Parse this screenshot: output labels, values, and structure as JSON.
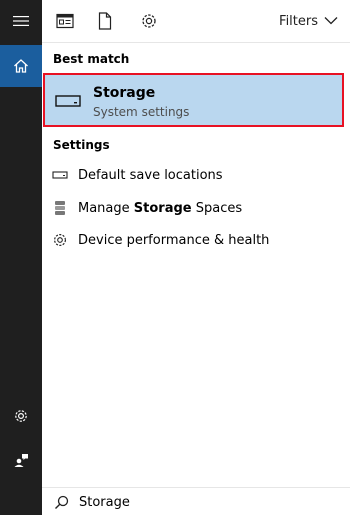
{
  "rail": {
    "items": [
      {
        "name": "menu-icon"
      },
      {
        "name": "home-icon"
      },
      {
        "name": "settings-icon"
      },
      {
        "name": "feedback-icon"
      }
    ]
  },
  "toolbar": {
    "icons": [
      "document-list-icon",
      "document-icon",
      "settings-icon"
    ],
    "filters_label": "Filters"
  },
  "best_match": {
    "section_label": "Best match",
    "title": "Storage",
    "subtitle": "System settings",
    "icon": "storage-drive-icon"
  },
  "settings": {
    "section_label": "Settings",
    "items": [
      {
        "label": "Default save locations",
        "icon": "drive-icon"
      },
      {
        "label_pre": "Manage ",
        "label_bold": "Storage",
        "label_post": " Spaces",
        "icon": "storage-spaces-icon"
      },
      {
        "label": "Device performance & health",
        "icon": "gear-icon"
      }
    ]
  },
  "search": {
    "value": "Storage",
    "icon": "search-icon"
  },
  "colors": {
    "rail_bg": "#1f1f1f",
    "rail_active": "#1b5e9e",
    "selection_bg": "#bad7ef",
    "selection_border": "#e81123"
  }
}
